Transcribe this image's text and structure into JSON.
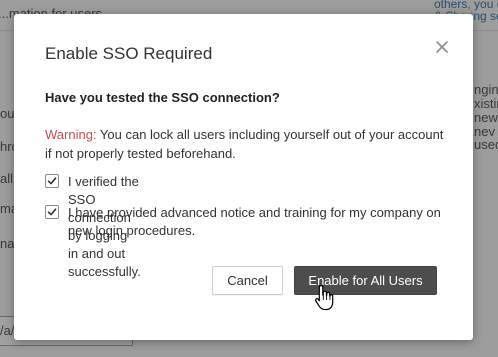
{
  "background": {
    "fragments": [
      "...mation for users",
      "our",
      "hro",
      "all",
      "ma",
      "na",
      "/a/S"
    ],
    "right_fragments": [
      "others, you can",
      "& Sharing se",
      "nging",
      "xistin",
      "new",
      "nev",
      "used"
    ]
  },
  "modal": {
    "title": "Enable SSO Required",
    "question": "Have you tested the SSO connection?",
    "warning_label": "Warning:",
    "warning_text": " You can lock all users including yourself out of your account if not properly tested beforehand.",
    "checkboxes": [
      {
        "label": "I verified the SSO connection by logging in and out successfully.",
        "checked": true
      },
      {
        "label": "I have provided advanced notice and training for my company on new login procedures.",
        "checked": true
      }
    ],
    "cancel_label": "Cancel",
    "enable_label": "Enable for All Users"
  },
  "icons": {
    "close": "close-icon",
    "check": "check-icon",
    "cursor": "hand-pointer-icon"
  },
  "colors": {
    "warning": "#c0504d",
    "primary_button": "#4d4d4d",
    "overlay": "rgba(0,0,0,0.32)"
  }
}
